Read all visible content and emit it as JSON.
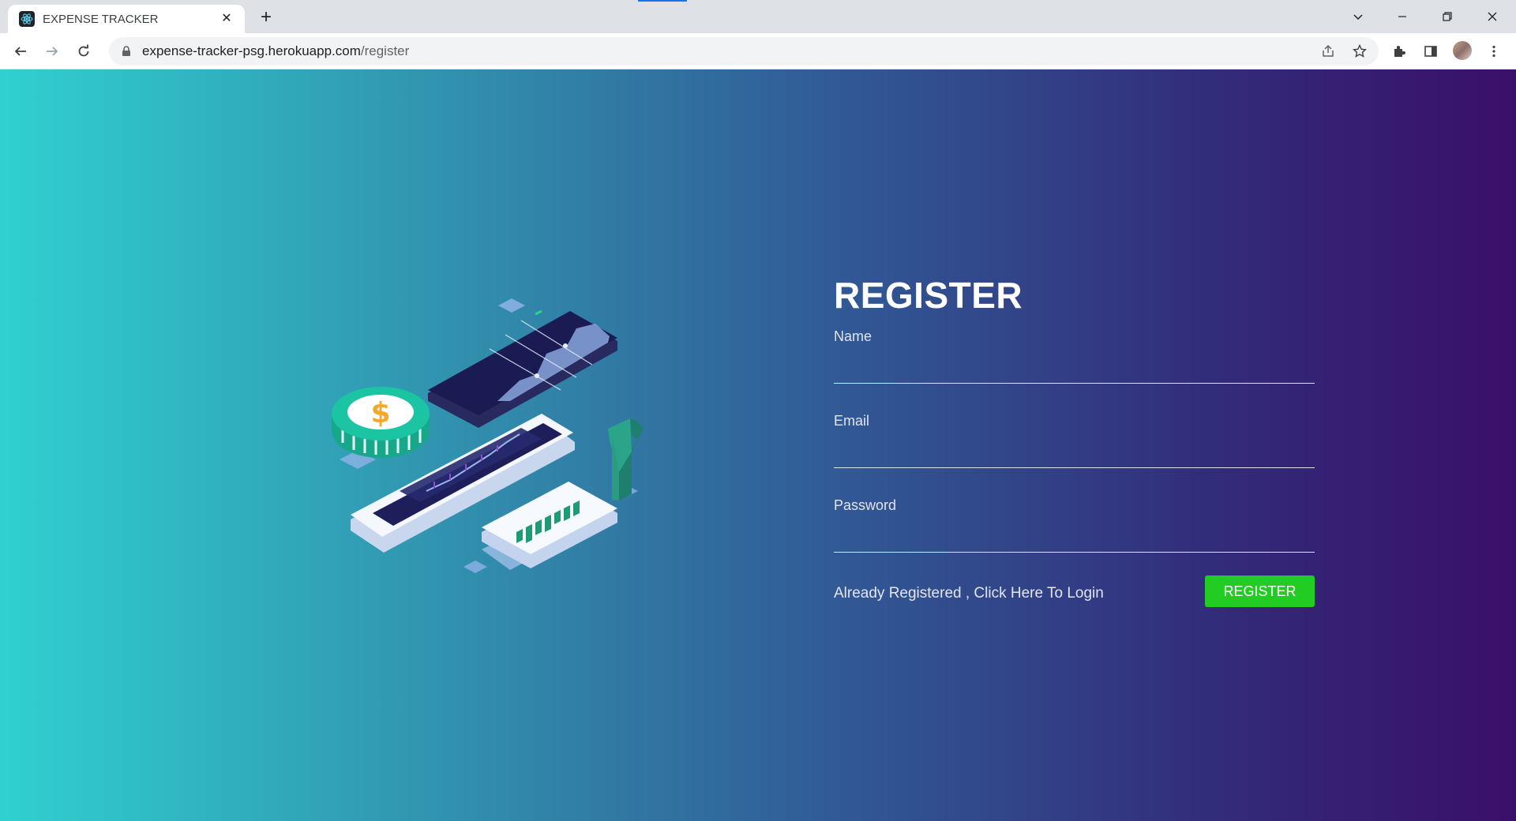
{
  "browser": {
    "tab_title": "EXPENSE TRACKER",
    "tab_favicon": "react-logo-icon",
    "url_host": "expense-tracker-psg.herokuapp.com",
    "url_path": "/register"
  },
  "register": {
    "title": "REGISTER",
    "fields": {
      "name_label": "Name",
      "name_value": "",
      "email_label": "Email",
      "email_value": "",
      "password_label": "Password",
      "password_value": ""
    },
    "login_link": "Already Registered , Click Here To Login",
    "submit_label": "REGISTER"
  },
  "hero": {
    "illustration": "isometric-phone-finance-illustration",
    "coin_symbol": "$"
  },
  "colors": {
    "gradient_start": "#30d0d0",
    "gradient_end": "#3a0f6a",
    "register_button": "#22cc22"
  }
}
